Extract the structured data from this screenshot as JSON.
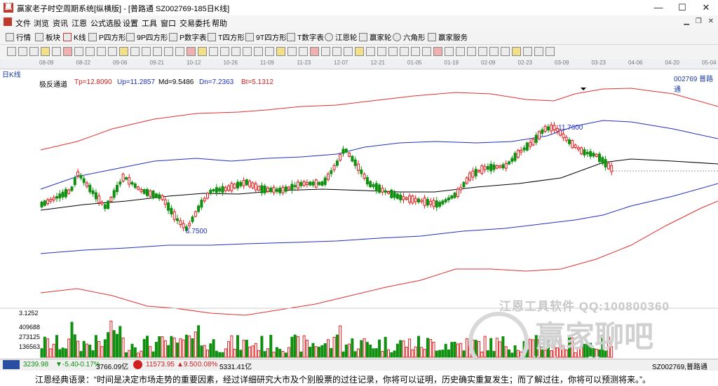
{
  "window": {
    "title": "赢家老子时空周期系统[纵横版] - [普路通  SZ002769-185日K线]",
    "controls": [
      "—",
      "☐",
      "✕"
    ]
  },
  "menu": [
    "文件",
    "浏览",
    "资讯",
    "江恩",
    "公式选股",
    "设置",
    "工具",
    "窗口",
    "交易委托",
    "帮助"
  ],
  "toolbar": [
    "行情",
    "板块",
    "K线",
    "P四方形",
    "9P四方形",
    "P数字表",
    "T四方形",
    "9T四方形",
    "T数字表",
    "江恩轮",
    "赢家轮",
    "六角形",
    "赢家服务"
  ],
  "date_axis": [
    "08-09",
    "08-22",
    "09-06",
    "09-21",
    "10-12",
    "10-26",
    "11-09",
    "11-23",
    "12-07",
    "12-21",
    "01-05",
    "01-19",
    "02-09",
    "02-23",
    "03-09",
    "03-23",
    "04-06",
    "04-20",
    "05-04"
  ],
  "info": {
    "period": "日K线",
    "indicator": "极反通道",
    "tp": "Tp=12.8090",
    "up": "Up=11.2857",
    "md": "Md=9.5486",
    "dn": "Dn=7.2363",
    "bt": "Bt=5.1312",
    "stock": "002769  普路通"
  },
  "chart_data": {
    "type": "candlestick",
    "high_label": "11.7600",
    "low_label": "6.7500",
    "volume_labels": [
      "3.1252",
      "409688",
      "273125",
      "136563"
    ]
  },
  "watermark": {
    "line1": "江恩工具软件  QQ:100800360",
    "line2": "赢家聊吧",
    "line3": "jiaoba.vic33"
  },
  "status": {
    "sh_index": "3239.98",
    "sh_change": "▼-5.40",
    "sh_pct": "-0.17%",
    "sh_amount": "3766.09亿",
    "sz_index": "11573.95",
    "sz_change": "▲9.50",
    "sz_pct": "0.08%",
    "sz_amount": "5331.41亿",
    "stock": "SZ002769,普路通"
  },
  "quote": "江恩经典语录：“时间是决定市场走势的重要因素，经过详细研究大市及个别股票的过往记录，你将可以证明，历史确实重复发生；而了解过往，你将可以预测将来。”。",
  "colors": {
    "up": "#e02020",
    "down": "#109010",
    "mid": "#000000",
    "upper": "#2030c0",
    "outer": "#e03030"
  }
}
